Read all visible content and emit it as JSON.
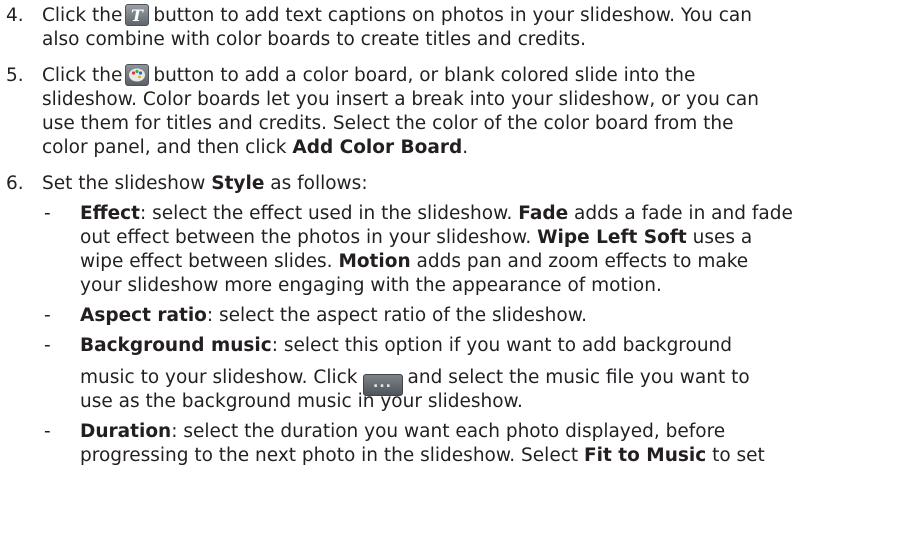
{
  "steps": {
    "s4": {
      "num": "4.",
      "line1_a": "Click the",
      "line1_b": "button to add text captions on photos in your slideshow. You can",
      "line2": "also combine with color boards to create titles and credits.",
      "icon": "text-t-icon"
    },
    "s5": {
      "num": "5.",
      "line1_a": "Click the",
      "line1_b": "button to add a color board, or blank colored slide into the",
      "line2": "slideshow. Color boards let you insert a break into your slideshow, or you can",
      "line3": "use them for titles and credits. Select the color of the color board from the",
      "line4_a": "color panel, and then click",
      "line4_b": "Add Color Board",
      "line4_c": ".",
      "icon": "color-palette-icon"
    },
    "s6": {
      "num": "6.",
      "line1_a": "Set the slideshow",
      "line1_b": "Style",
      "line1_c": "as follows:"
    }
  },
  "bullets": {
    "dash": "-",
    "effect": {
      "l1_b": "Effect",
      "l1_r": ": select the effect used in the slideshow.",
      "l1_b2": "Fade",
      "l1_r2": "adds a fade in and fade",
      "l2_a": "out effect between the photos in your slideshow.",
      "l2_b": "Wipe Left Soft",
      "l2_c": "uses a",
      "l3_a": "wipe effect between slides.",
      "l3_b": "Motion",
      "l3_c": "adds pan and zoom effects to make",
      "l4": "your slideshow more engaging with the appearance of motion."
    },
    "aspect": {
      "b": "Aspect ratio",
      "r": ": select the aspect ratio of the slideshow."
    },
    "music": {
      "b": "Background music",
      "r": ": select this option if you want to add background",
      "l2_a": "music to your slideshow. Click",
      "l2_b": "and select the music file you want to",
      "l3": "use as the background music in your slideshow.",
      "button_label": "..."
    },
    "duration": {
      "b": "Duration",
      "r": ": select the duration you want each photo displayed, before",
      "l2_a": "progressing to the next photo in the slideshow. Select",
      "l2_b": "Fit to Music",
      "l2_c": "to set"
    }
  }
}
